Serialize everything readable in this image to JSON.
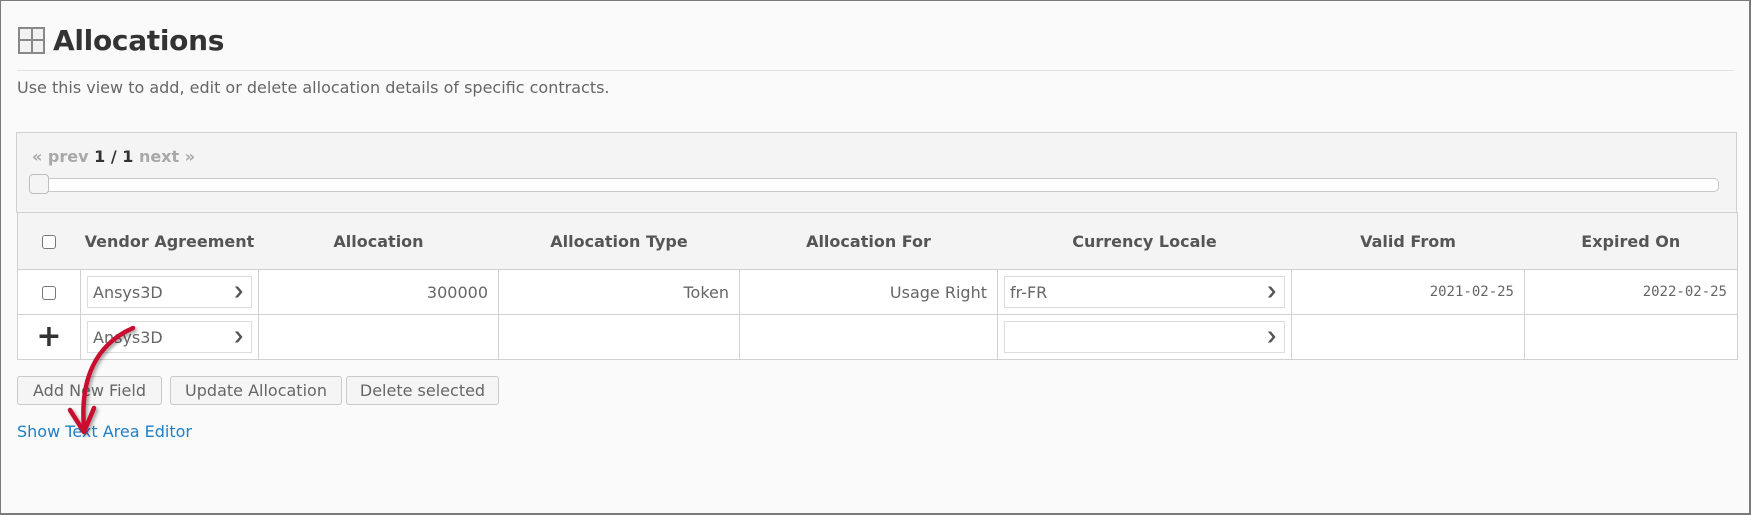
{
  "header": {
    "title": "Allocations",
    "icon": "grid-view-icon",
    "description": "Use this view to add, edit or delete allocation details of specific contracts."
  },
  "pagination": {
    "prev_label": "« prev",
    "current": "1 / 1",
    "next_label": "next »",
    "slider_position": 0
  },
  "table": {
    "columns": [
      "Vendor Agreement",
      "Allocation",
      "Allocation Type",
      "Allocation For",
      "Currency Locale",
      "Valid From",
      "Expired On"
    ],
    "rows": [
      {
        "selected": false,
        "vendor_agreement": "Ansys3D",
        "allocation": "300000",
        "allocation_type": "Token",
        "allocation_for": "Usage Right",
        "currency_locale": "fr-FR",
        "valid_from": "2021-02-25",
        "expired_on": "2022-02-25"
      }
    ],
    "new_row": {
      "add_icon": "plus-icon",
      "vendor_agreement": "Ansys3D",
      "allocation": "",
      "allocation_type": "",
      "allocation_for": "",
      "currency_locale": "",
      "valid_from": "",
      "expired_on": ""
    }
  },
  "actions": {
    "add_new_field": "Add New Field",
    "update_allocation": "Update Allocation",
    "delete_selected": "Delete selected",
    "show_text_area_editor": "Show Text Area Editor"
  },
  "annotation": {
    "type": "red-curved-arrow",
    "color": "#c8102e",
    "points_to": "Show Text Area Editor"
  }
}
